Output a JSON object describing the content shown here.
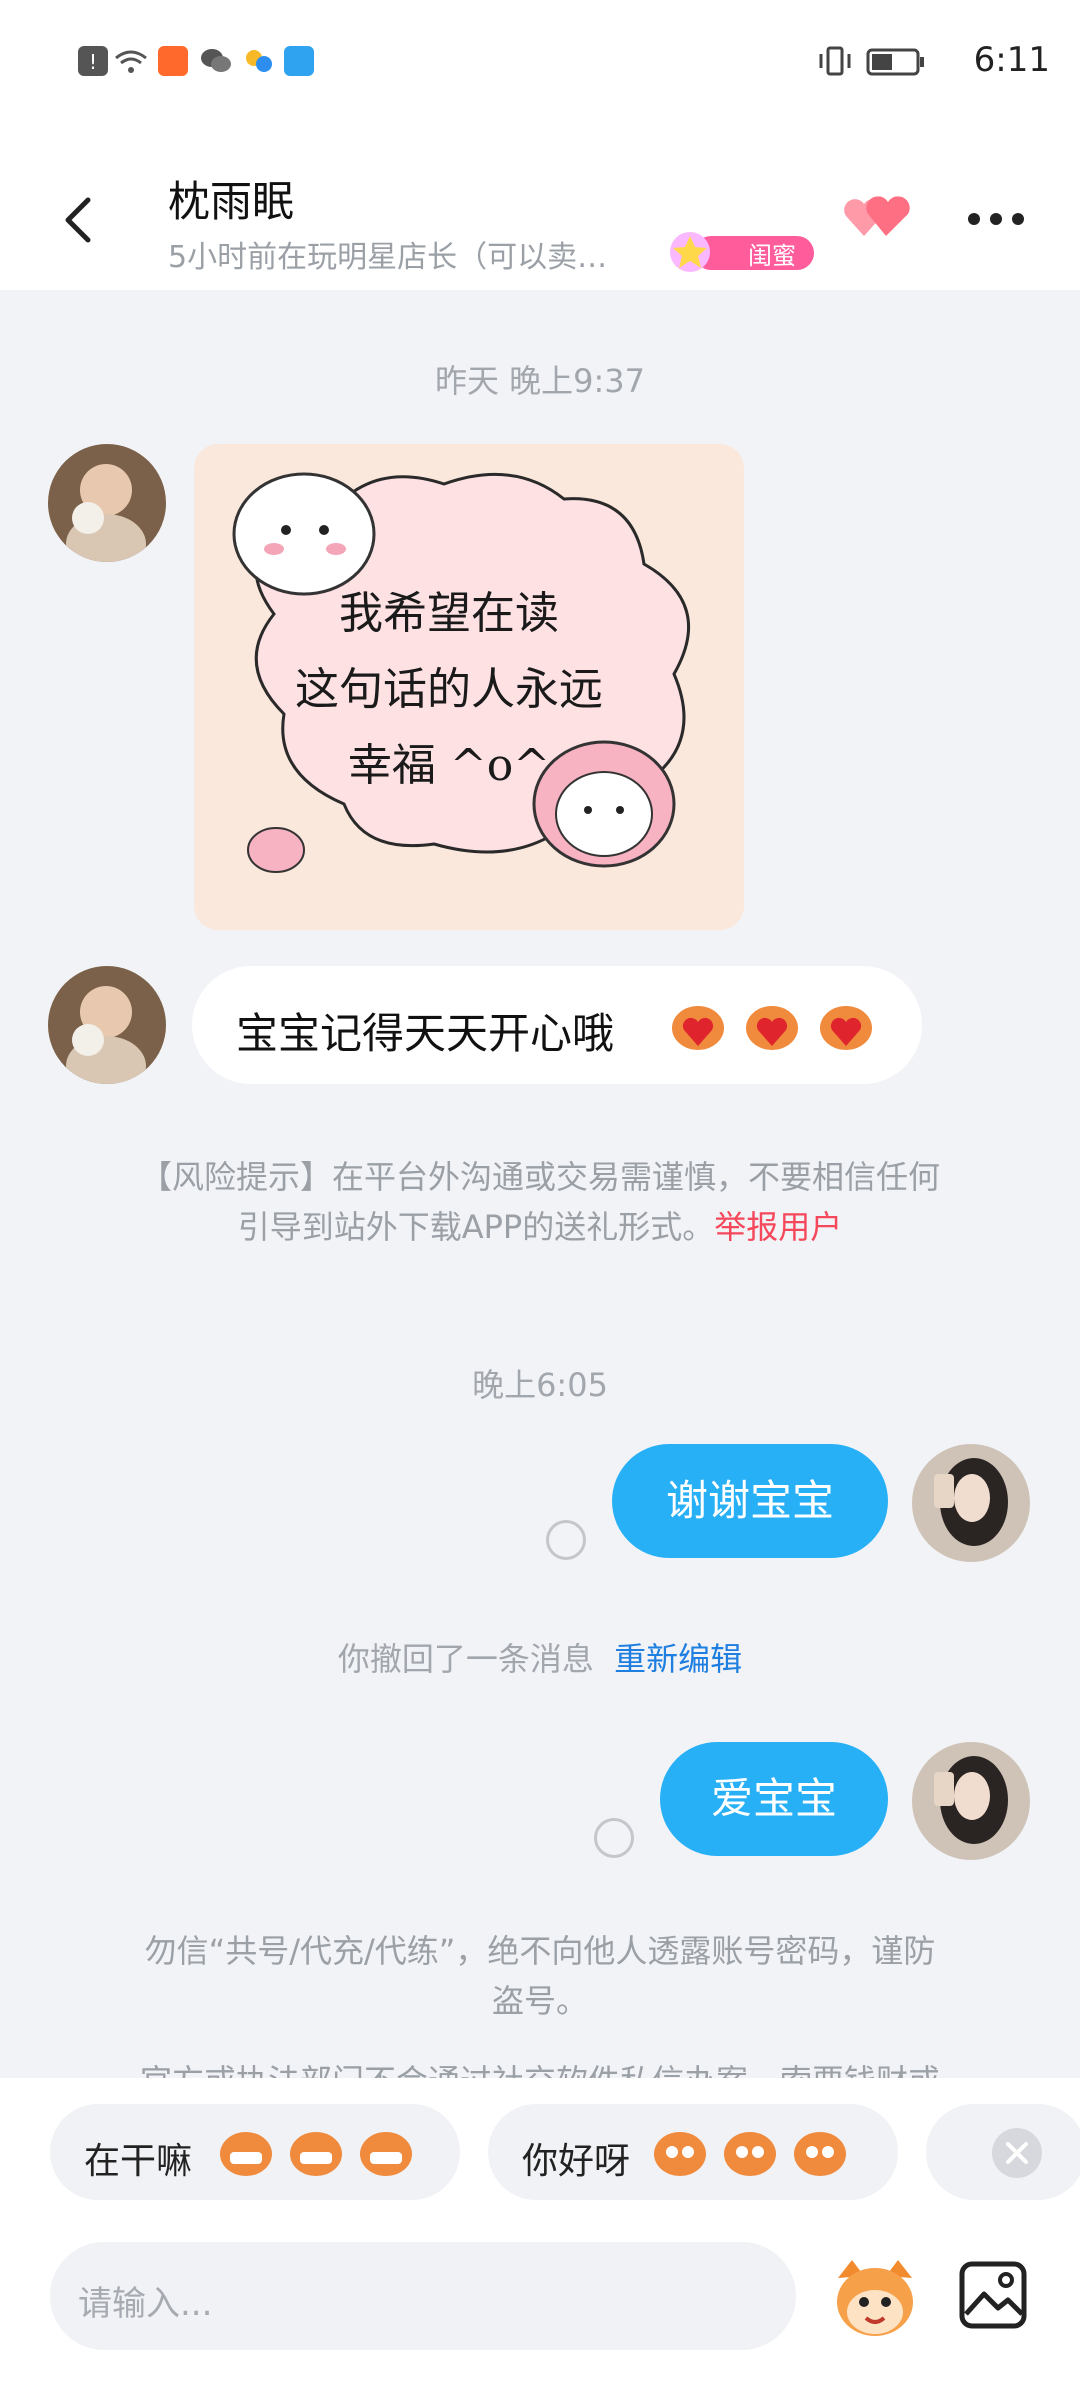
{
  "status_bar": {
    "time": "6:11"
  },
  "header": {
    "contact_name": "枕雨眠",
    "status_text": "5小时前在玩明星店长（可以卖…",
    "relation_badge": "闺蜜"
  },
  "messages": {
    "ts_yesterday": "昨天 晚上9:37",
    "sticker_text": [
      "我希望在读",
      "这句话的人永远",
      "幸福 ^o^"
    ],
    "incoming_text": "宝宝记得天天开心哦",
    "risk_notice_line1": "【风险提示】在平台外沟通或交易需谨慎，不要相信任何",
    "risk_notice_line2": "引导到站外下载APP的送礼形式。",
    "report_link": "举报用户",
    "ts_today": "晚上6:05",
    "out_msg_1": "谢谢宝宝",
    "recall_text": "你撤回了一条消息",
    "reedit_link": "重新编辑",
    "out_msg_2": "爱宝宝",
    "security_line1": "勿信“共号/代充/代练”，绝不向他人透露账号密码，谨防",
    "security_line2": "盗号。",
    "cut_line": "官方或执法部门不会通过社交软件私信办案，索要钱财或"
  },
  "quick_replies": [
    "在干嘛",
    "你好呀"
  ],
  "input": {
    "placeholder": "请输入..."
  },
  "colors": {
    "accent_blue": "#27b0f6",
    "link_red": "#f5485b",
    "link_blue": "#1f7fe0"
  }
}
